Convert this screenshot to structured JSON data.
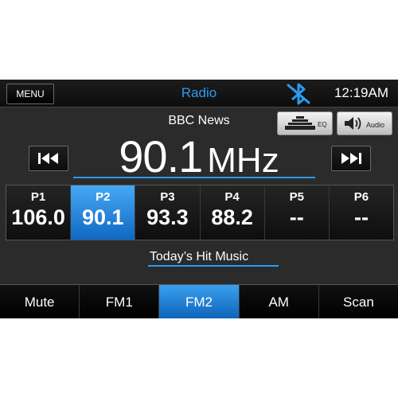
{
  "header": {
    "menu_label": "MENU",
    "title": "Radio",
    "clock": "12:19AM",
    "bluetooth_icon": "bluetooth-muted-icon"
  },
  "station": {
    "name": "BBC News",
    "frequency": "90.1",
    "unit": "MHz",
    "radio_text": "Today’s Hit Music"
  },
  "controls": {
    "eq_label": "EQ",
    "audio_label": "Audio",
    "seek_prev_icon": "skip-back-icon",
    "seek_next_icon": "skip-forward-icon"
  },
  "presets": [
    {
      "label": "P1",
      "value": "106.0",
      "active": false
    },
    {
      "label": "P2",
      "value": "90.1",
      "active": true
    },
    {
      "label": "P3",
      "value": "93.3",
      "active": false
    },
    {
      "label": "P4",
      "value": "88.2",
      "active": false
    },
    {
      "label": "P5",
      "value": "--",
      "active": false
    },
    {
      "label": "P6",
      "value": "--",
      "active": false
    }
  ],
  "bottom_tabs": [
    {
      "label": "Mute",
      "active": false
    },
    {
      "label": "FM1",
      "active": false
    },
    {
      "label": "FM2",
      "active": true
    },
    {
      "label": "AM",
      "active": false
    },
    {
      "label": "Scan",
      "active": false
    }
  ],
  "colors": {
    "accent": "#2a9bf0",
    "background": "#2b2b2b"
  }
}
